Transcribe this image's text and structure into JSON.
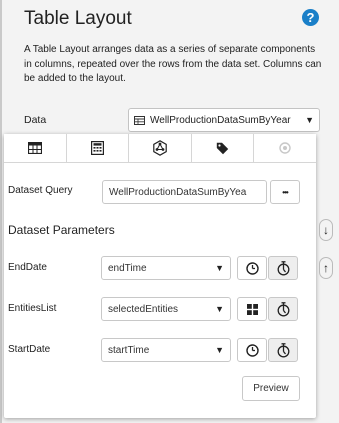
{
  "header": {
    "title": "Table Layout",
    "help_icon": "?",
    "description": "A Table Layout arranges data as a series of separate components in columns, repeated over the rows from the data set. Columns can be added to the layout."
  },
  "data_field": {
    "label": "Data",
    "value": "WellProductionDataSumByYear",
    "icon": "table-icon"
  },
  "tabs": [
    {
      "name": "table-icon"
    },
    {
      "name": "calculator-icon"
    },
    {
      "name": "network-icon"
    },
    {
      "name": "tag-icon"
    },
    {
      "name": "circle-icon"
    }
  ],
  "dataset_query": {
    "label": "Dataset Query",
    "value": "WellProductionDataSumByYea",
    "button_label": "•••"
  },
  "dataset_parameters": {
    "title": "Dataset Parameters",
    "params": [
      {
        "label": "EndDate",
        "value": "endTime",
        "first_button_icon": "clock-icon"
      },
      {
        "label": "EntitiesList",
        "value": "selectedEntities",
        "first_button_icon": "grid-icon"
      },
      {
        "label": "StartDate",
        "value": "startTime",
        "first_button_icon": "clock-icon"
      }
    ]
  },
  "preview_button": "Preview",
  "side_arrows": [
    "↓",
    "↑"
  ],
  "colors": {
    "accent": "#1a7fc8",
    "background": "#f3f3f3",
    "panel": "#ffffff",
    "border": "#c8c8c8"
  }
}
